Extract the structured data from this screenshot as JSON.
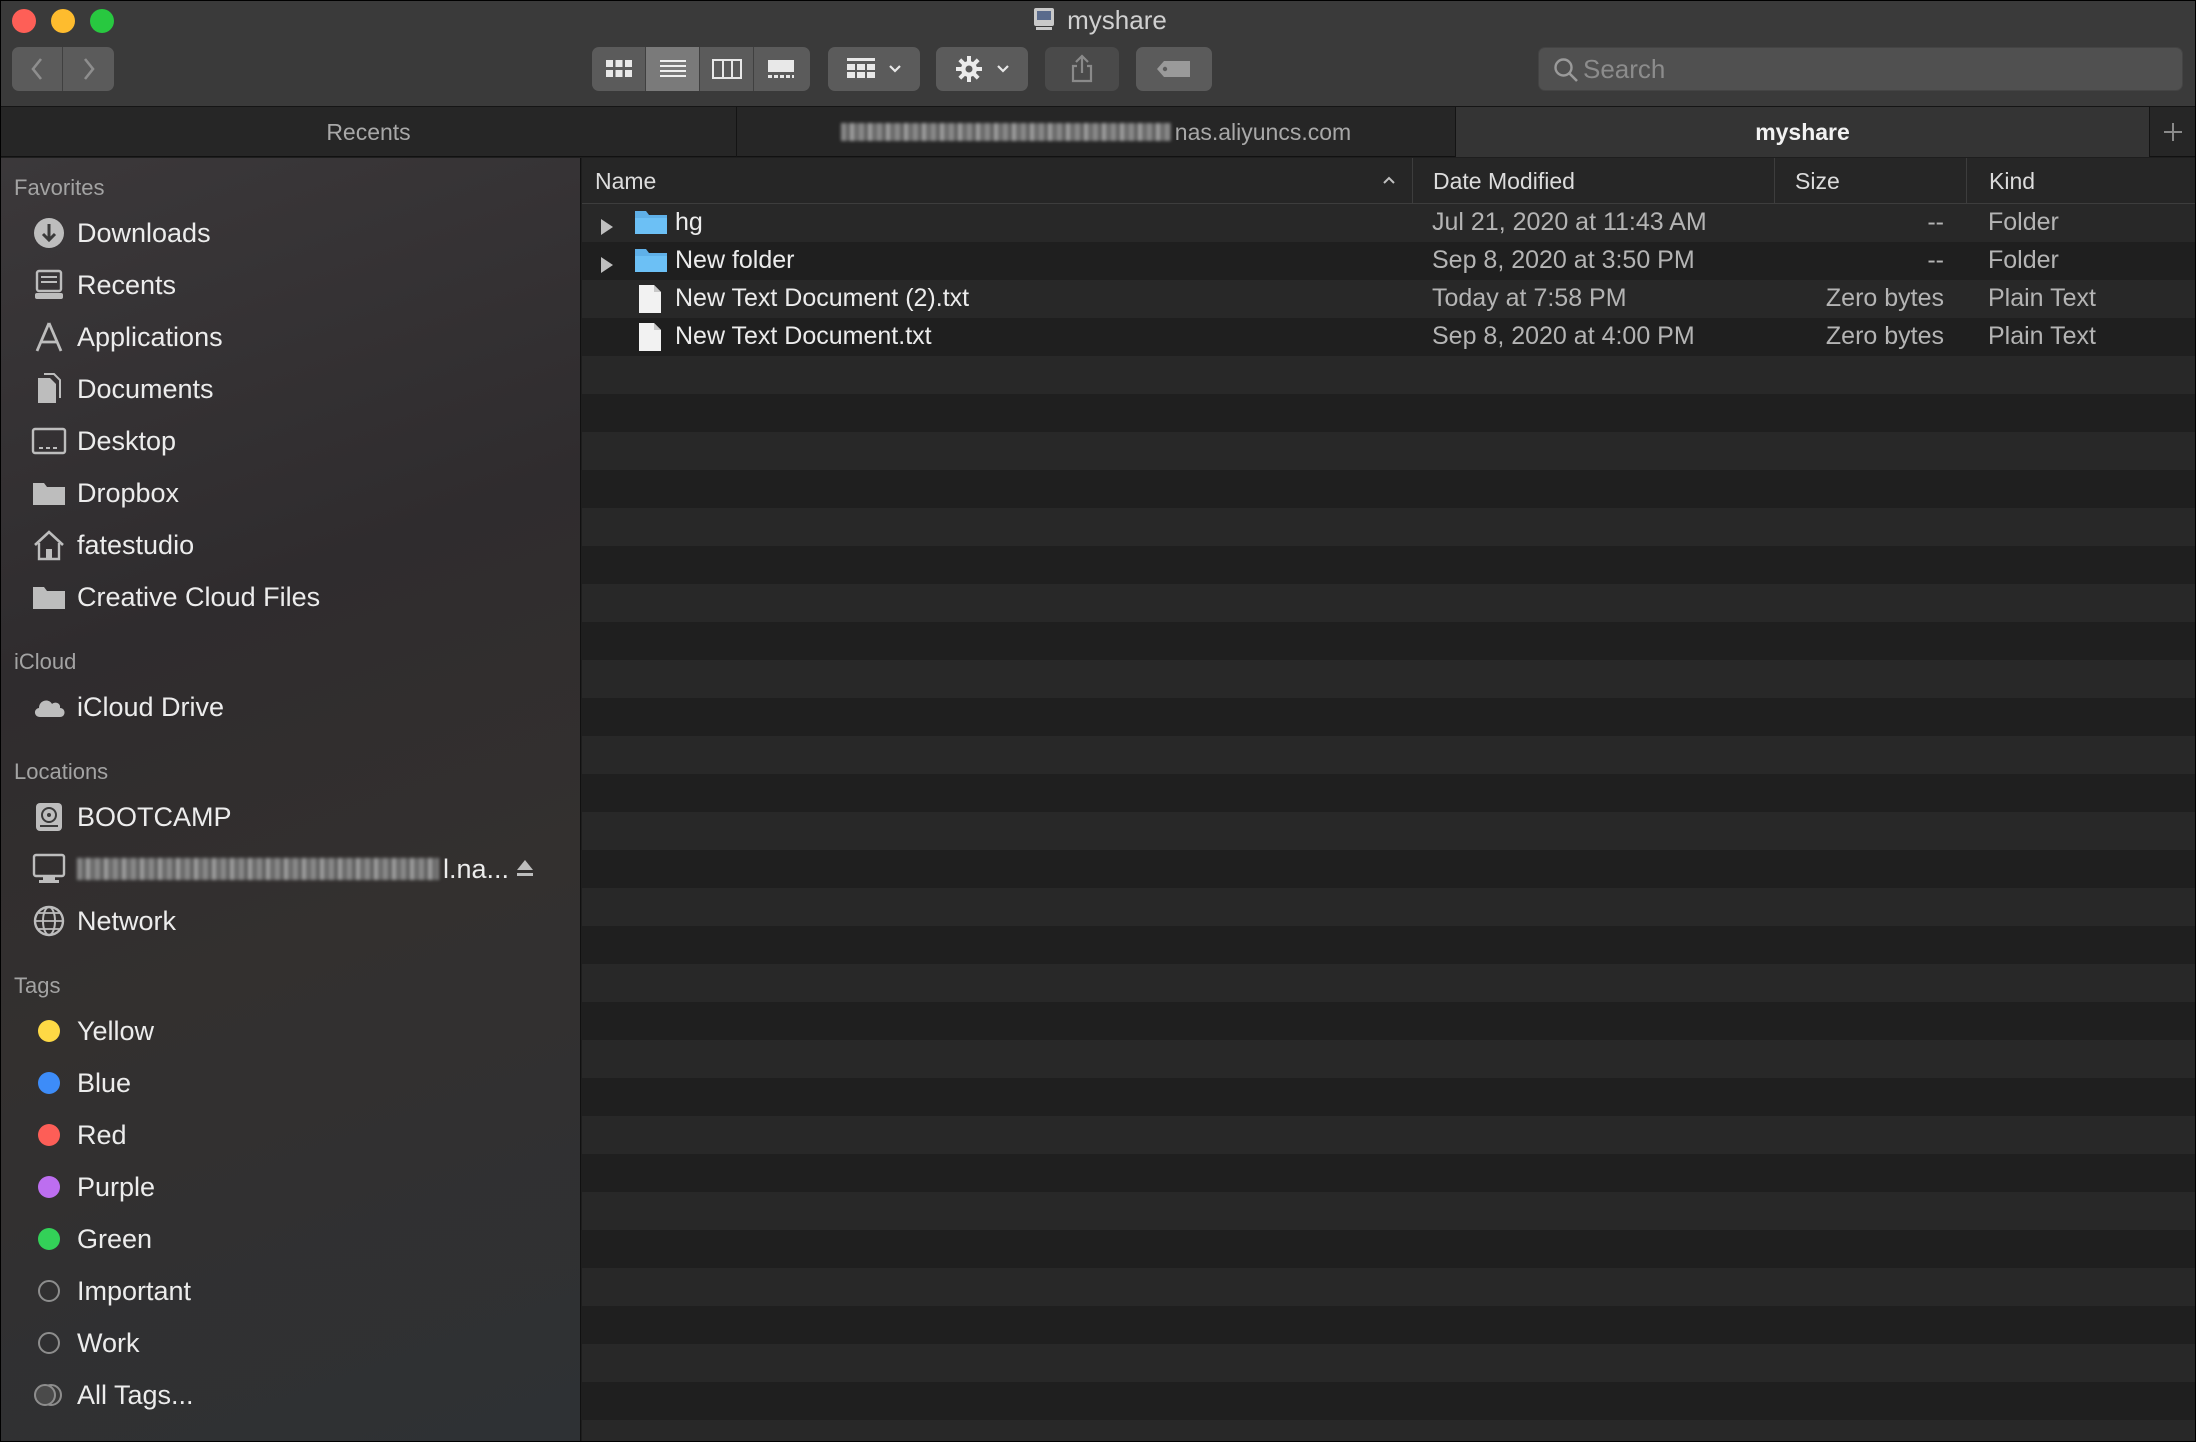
{
  "window": {
    "title": "myshare",
    "title_icon": "network-drive-icon"
  },
  "toolbar": {
    "back_icon": "chevron-left-icon",
    "forward_icon": "chevron-right-icon",
    "view_modes": [
      "icon-view-icon",
      "list-view-icon",
      "column-view-icon",
      "gallery-view-icon"
    ],
    "active_view": "list",
    "group_icon": "group-by-icon",
    "action_icon": "gear-icon",
    "share_icon": "share-icon",
    "tag_icon": "tag-icon"
  },
  "search": {
    "placeholder": "Search"
  },
  "tabs": [
    {
      "label": "Recents",
      "active": false
    },
    {
      "label": "nas.aliyuncs.com",
      "active": false,
      "redacted_prefix": true
    },
    {
      "label": "myshare",
      "active": true
    }
  ],
  "sidebar": {
    "favorites_title": "Favorites",
    "favorites": [
      {
        "label": "Downloads",
        "icon": "downloads-icon"
      },
      {
        "label": "Recents",
        "icon": "recents-icon"
      },
      {
        "label": "Applications",
        "icon": "applications-icon"
      },
      {
        "label": "Documents",
        "icon": "documents-icon"
      },
      {
        "label": "Desktop",
        "icon": "desktop-icon"
      },
      {
        "label": "Dropbox",
        "icon": "folder-icon"
      },
      {
        "label": "fatestudio",
        "icon": "home-icon"
      },
      {
        "label": "Creative Cloud Files",
        "icon": "folder-icon"
      }
    ],
    "icloud_title": "iCloud",
    "icloud": [
      {
        "label": "iCloud Drive",
        "icon": "cloud-icon"
      }
    ],
    "locations_title": "Locations",
    "locations": [
      {
        "label": "BOOTCAMP",
        "icon": "disk-icon"
      },
      {
        "label": "l.na...",
        "icon": "computer-icon",
        "redacted_prefix": true,
        "eject": true
      },
      {
        "label": "Network",
        "icon": "network-icon"
      }
    ],
    "tags_title": "Tags",
    "tags": [
      {
        "label": "Yellow",
        "color": "#fed945"
      },
      {
        "label": "Blue",
        "color": "#3d8cf8"
      },
      {
        "label": "Red",
        "color": "#fd5e57"
      },
      {
        "label": "Purple",
        "color": "#bd6ef0"
      },
      {
        "label": "Green",
        "color": "#33d158"
      },
      {
        "label": "Important",
        "color": ""
      },
      {
        "label": "Work",
        "color": ""
      },
      {
        "label": "All Tags...",
        "color": ""
      }
    ]
  },
  "columns": {
    "name": "Name",
    "date": "Date Modified",
    "size": "Size",
    "kind": "Kind"
  },
  "files": [
    {
      "name": "hg",
      "date": "Jul 21, 2020 at 11:43 AM",
      "size": "--",
      "kind": "Folder",
      "type": "folder"
    },
    {
      "name": "New folder",
      "date": "Sep 8, 2020 at 3:50 PM",
      "size": "--",
      "kind": "Folder",
      "type": "folder"
    },
    {
      "name": "New Text Document (2).txt",
      "date": "Today at 7:58 PM",
      "size": "Zero bytes",
      "kind": "Plain Text",
      "type": "file"
    },
    {
      "name": "New Text Document.txt",
      "date": "Sep 8, 2020 at 4:00 PM",
      "size": "Zero bytes",
      "kind": "Plain Text",
      "type": "file"
    }
  ],
  "colors": {
    "accent_folder": "#5fb0e8",
    "sidebar_text": "#ececec",
    "secondary_text": "#b4b4b4"
  }
}
